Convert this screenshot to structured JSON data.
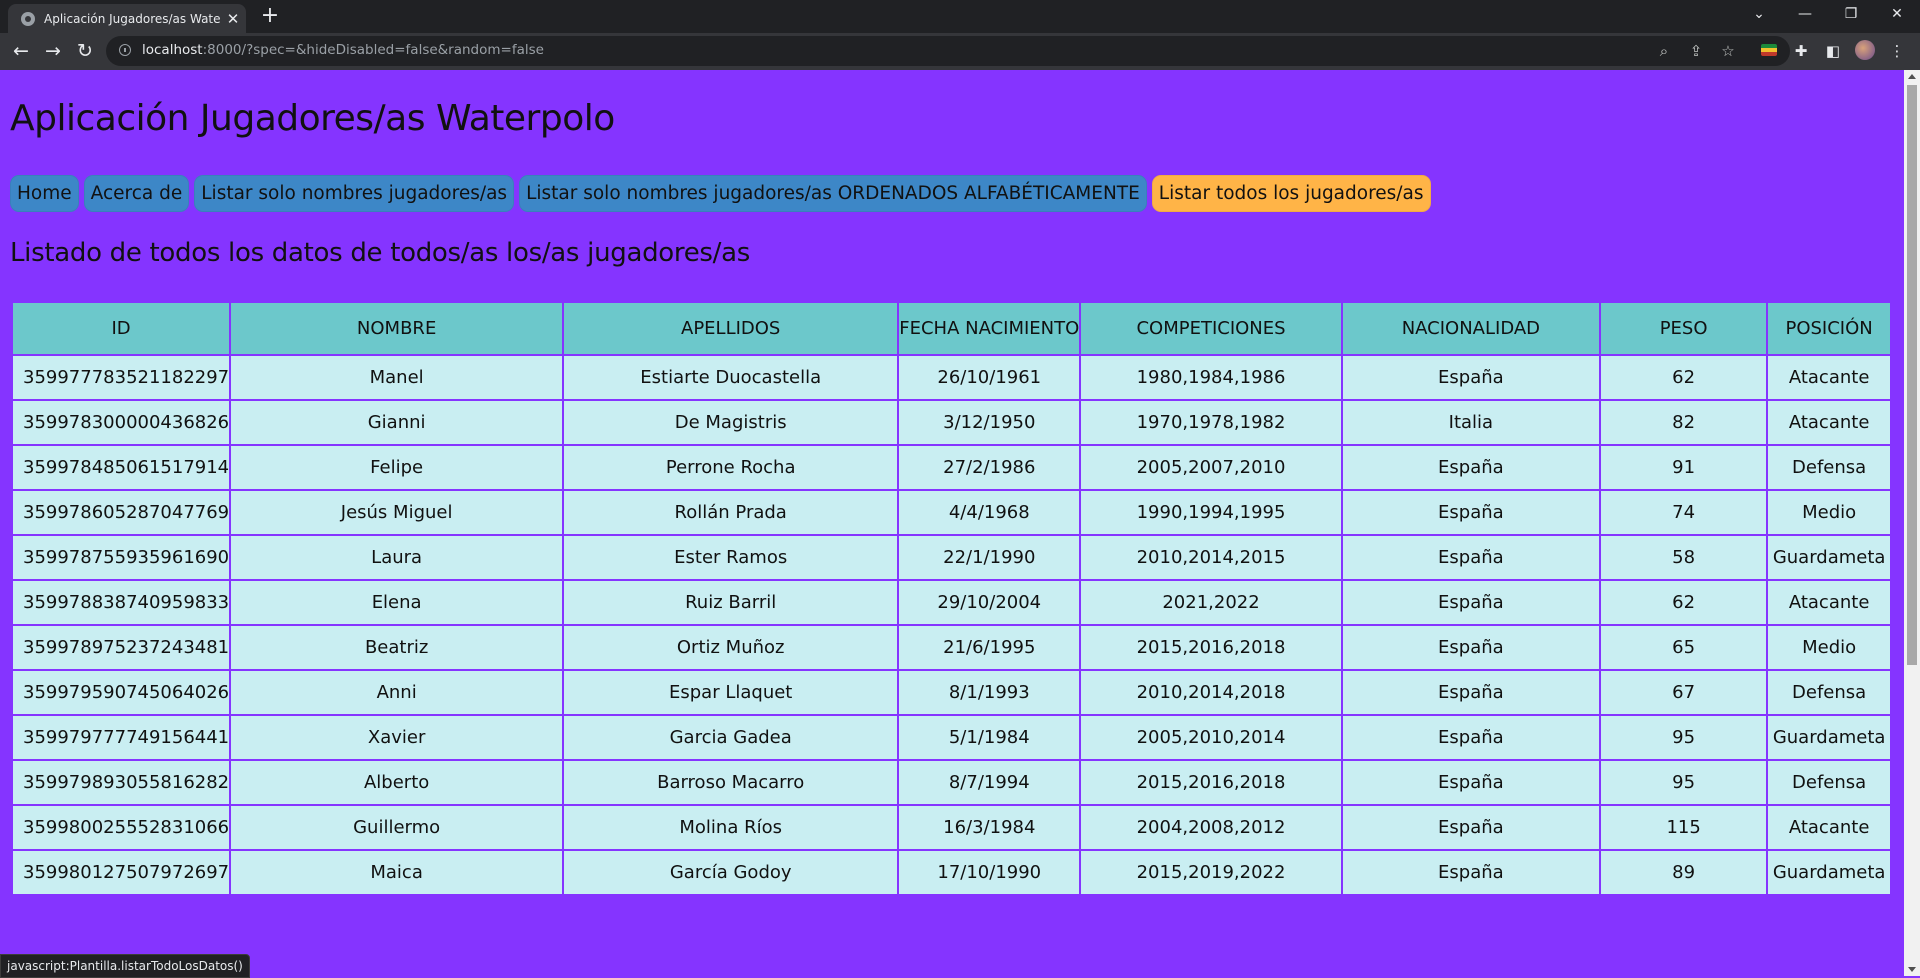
{
  "browser": {
    "tab_title": "Aplicación Jugadores/as Waterpolo",
    "url_host": "localhost",
    "url_rest": ":8000/?spec=&hideDisabled=false&random=false",
    "status_text": "javascript:Plantilla.listarTodoLosDatos()"
  },
  "page": {
    "title": "Aplicación Jugadores/as Waterpolo",
    "nav": [
      {
        "label": "Home",
        "active": false
      },
      {
        "label": "Acerca de",
        "active": false
      },
      {
        "label": "Listar solo nombres jugadores/as",
        "active": false
      },
      {
        "label": "Listar solo nombres jugadores/as ORDENADOS ALFABÉTICAMENTE",
        "active": false
      },
      {
        "label": "Listar todos los jugadores/as",
        "active": true
      }
    ],
    "subtitle": "Listado de todos los datos de todos/as los/as jugadores/as"
  },
  "table": {
    "headers": [
      "ID",
      "NOMBRE",
      "APELLIDOS",
      "FECHA NACIMIENTO",
      "COMPETICIONES",
      "NACIONALIDAD",
      "PESO",
      "POSICIÓN"
    ],
    "rows": [
      [
        "359977783521182297",
        "Manel",
        "Estiarte Duocastella",
        "26/10/1961",
        "1980,1984,1986",
        "España",
        "62",
        "Atacante"
      ],
      [
        "359978300000436826",
        "Gianni",
        "De Magistris",
        "3/12/1950",
        "1970,1978,1982",
        "Italia",
        "82",
        "Atacante"
      ],
      [
        "359978485061517914",
        "Felipe",
        "Perrone Rocha",
        "27/2/1986",
        "2005,2007,2010",
        "España",
        "91",
        "Defensa"
      ],
      [
        "359978605287047769",
        "Jesús Miguel",
        "Rollán Prada",
        "4/4/1968",
        "1990,1994,1995",
        "España",
        "74",
        "Medio"
      ],
      [
        "359978755935961690",
        "Laura",
        "Ester Ramos",
        "22/1/1990",
        "2010,2014,2015",
        "España",
        "58",
        "Guardameta"
      ],
      [
        "359978838740959833",
        "Elena",
        "Ruiz Barril",
        "29/10/2004",
        "2021,2022",
        "España",
        "62",
        "Atacante"
      ],
      [
        "359978975237243481",
        "Beatriz",
        "Ortiz Muñoz",
        "21/6/1995",
        "2015,2016,2018",
        "España",
        "65",
        "Medio"
      ],
      [
        "359979590745064026",
        "Anni",
        "Espar Llaquet",
        "8/1/1993",
        "2010,2014,2018",
        "España",
        "67",
        "Defensa"
      ],
      [
        "359979777749156441",
        "Xavier",
        "Garcia Gadea",
        "5/1/1984",
        "2005,2010,2014",
        "España",
        "95",
        "Guardameta"
      ],
      [
        "359979893055816282",
        "Alberto",
        "Barroso Macarro",
        "8/7/1994",
        "2015,2016,2018",
        "España",
        "95",
        "Defensa"
      ],
      [
        "359980025552831066",
        "Guillermo",
        "Molina Ríos",
        "16/3/1984",
        "2004,2008,2012",
        "España",
        "115",
        "Atacante"
      ],
      [
        "359980127507972697",
        "Maica",
        "García Godoy",
        "17/10/1990",
        "2015,2019,2022",
        "España",
        "89",
        "Guardameta"
      ]
    ]
  },
  "colors": {
    "page_bg": "#8534ff",
    "nav_button": "#3d87c7",
    "nav_active": "#ffb447",
    "table_header": "#6cc8cb",
    "table_cell": "#c9eef2"
  }
}
